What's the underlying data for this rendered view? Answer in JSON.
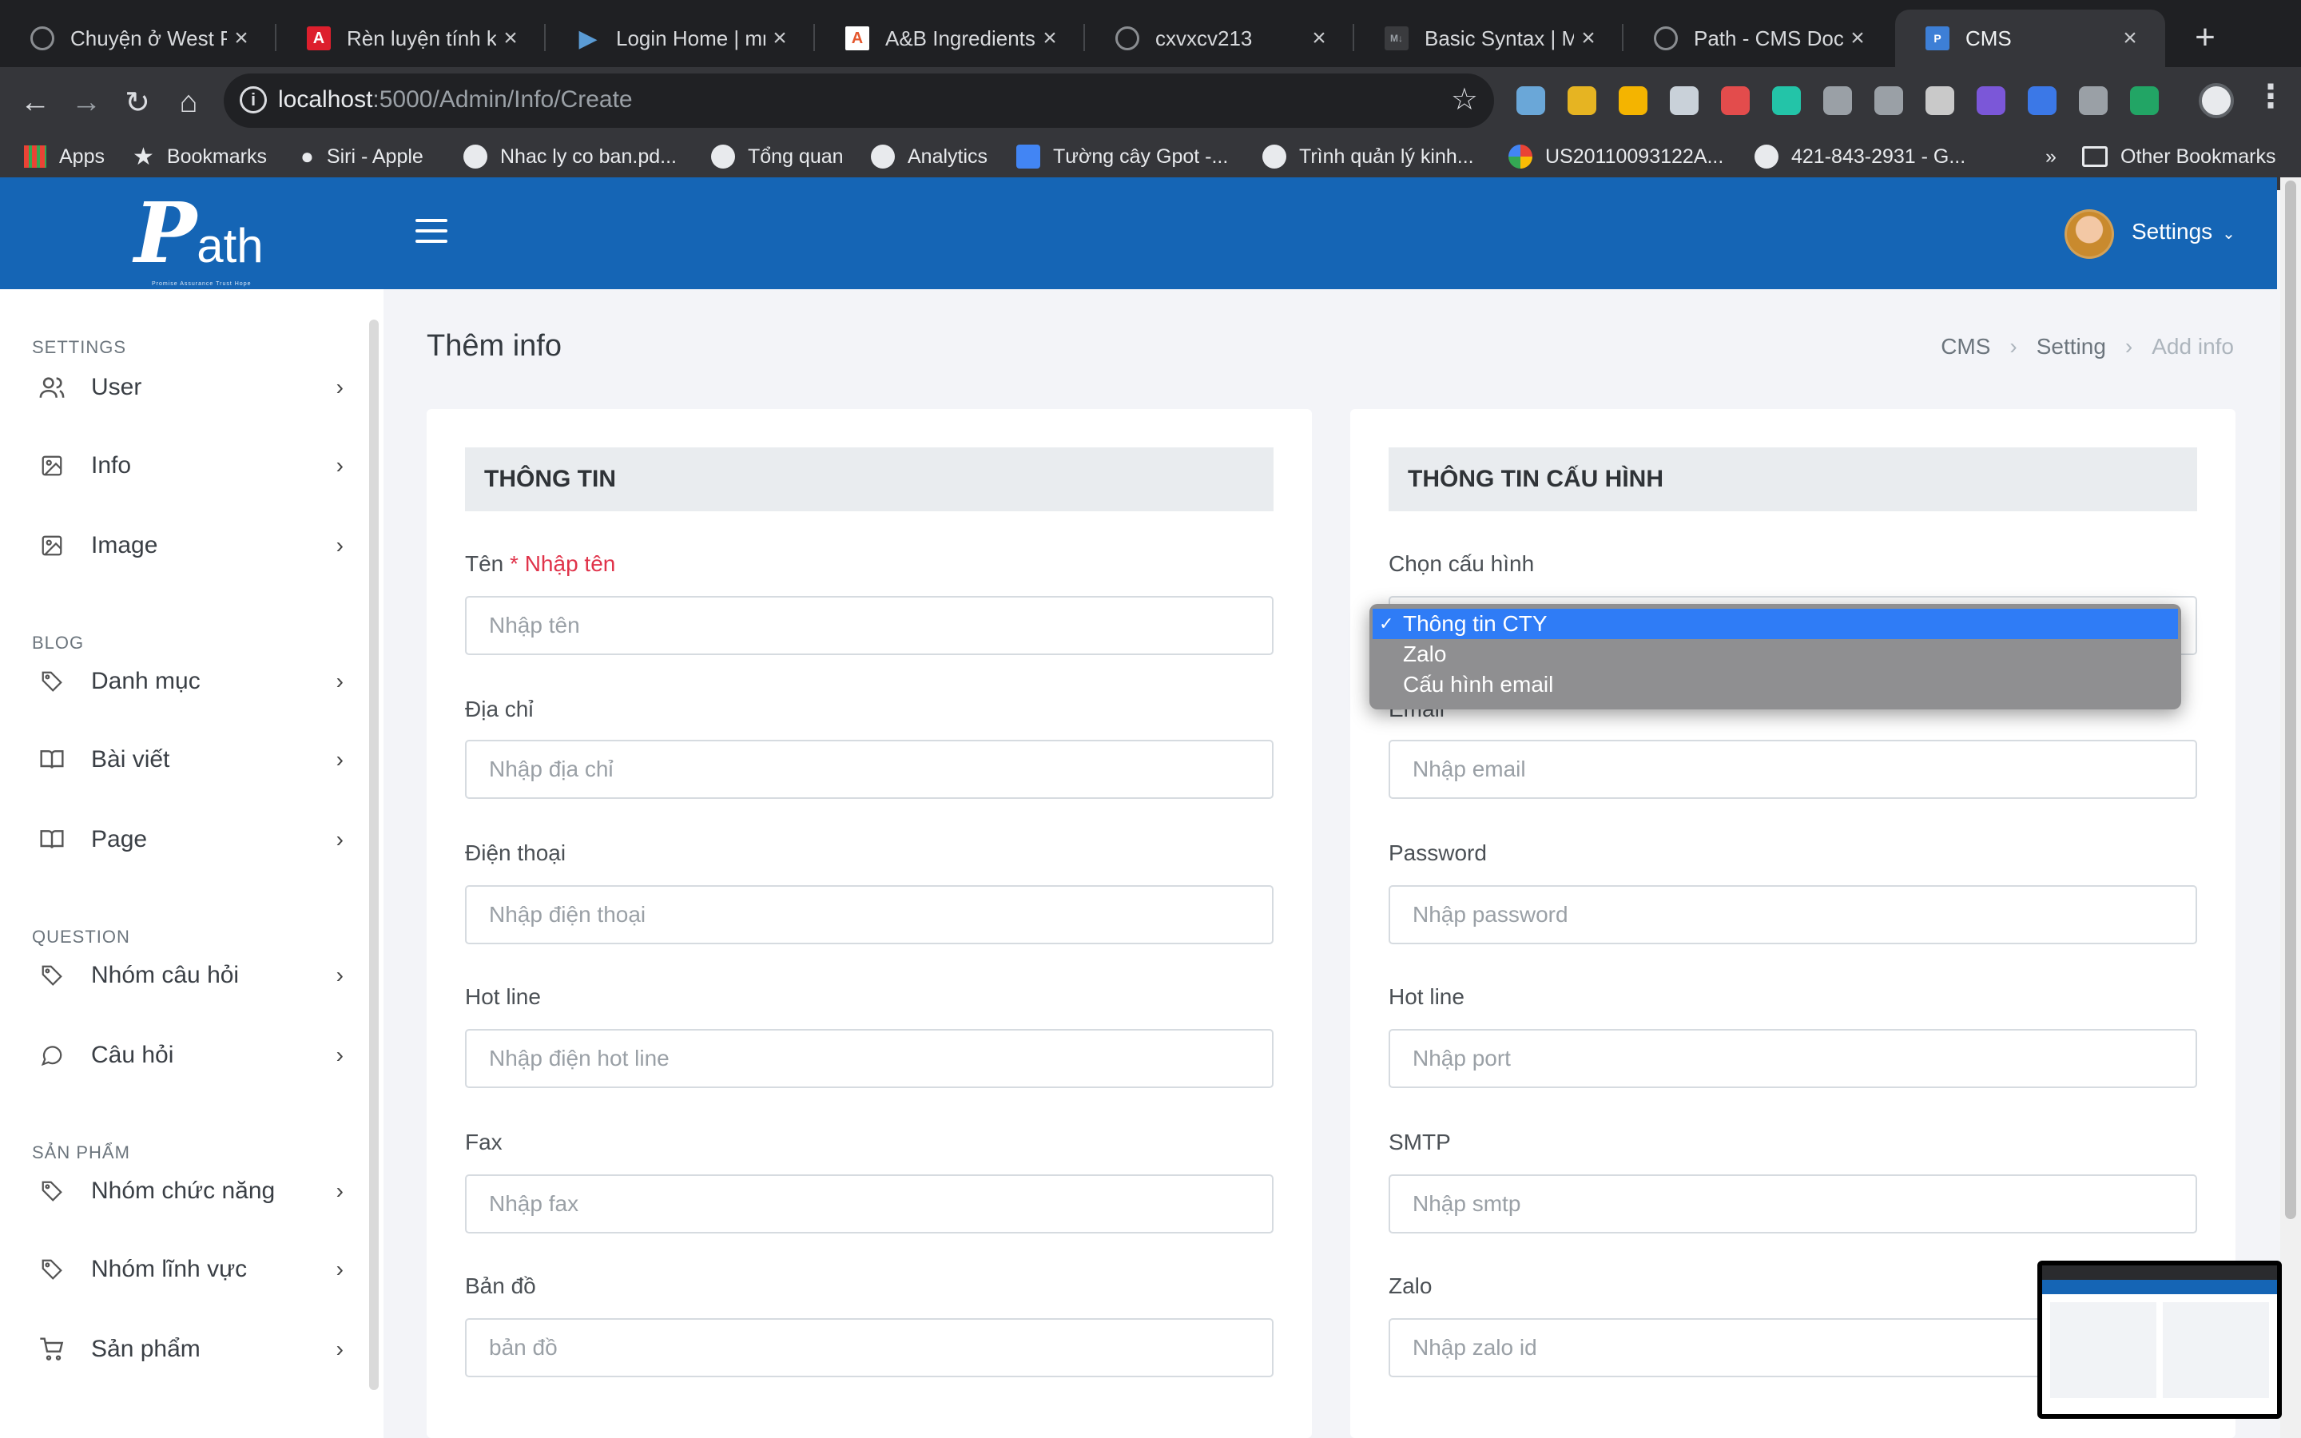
{
  "browser": {
    "tabs": [
      {
        "title": "Chuyện ở West Po",
        "fav_color": "#8a8d91"
      },
      {
        "title": "Rèn luyện tính kỷ l",
        "fav_color": "#dd1f2d"
      },
      {
        "title": "Login Home | mmr",
        "fav_color": "#5a9bd4"
      },
      {
        "title": "A&B Ingredients -",
        "fav_color": "#e4572e"
      },
      {
        "title": "cxvxcv213",
        "fav_color": "#8a8d91"
      },
      {
        "title": "Basic Syntax | Mar",
        "fav_color": "#8a8d91"
      },
      {
        "title": "Path - CMS Docum",
        "fav_color": "#8a8d91"
      },
      {
        "title": "CMS",
        "fav_color": "#3d7fd6",
        "active": true
      }
    ],
    "url_host": "localhost",
    "url_path": ":5000/Admin/Info/Create",
    "bookmarks": [
      "Apps",
      "Bookmarks",
      "Siri - Apple",
      "Nhac ly co ban.pd...",
      "Tổng quan",
      "Analytics",
      "Tường cây Gpot -...",
      "Trình quản lý kinh...",
      "US20110093122A...",
      "421-843-2931 - G...",
      "»",
      "Other Bookmarks"
    ],
    "extension_colors": [
      "#6aa7d8",
      "#e6b422",
      "#f4b400",
      "#c9d1d9",
      "#e34c4c",
      "#23c4a8",
      "#9aa0a6",
      "#9aa0a6",
      "#c9c9c9",
      "#7b57d8",
      "#3b78e7",
      "#9aa0a6",
      "#22a565"
    ]
  },
  "header": {
    "logo_big": "P",
    "logo_rest": "ath",
    "logo_tagline": "Promise Assurance Trust Hope",
    "settings_label": "Settings"
  },
  "sidebar": {
    "sections": [
      {
        "title": "SETTINGS",
        "items": [
          {
            "label": "User",
            "icon": "users-icon"
          },
          {
            "label": "Info",
            "icon": "image-icon"
          },
          {
            "label": "Image",
            "icon": "image-icon"
          }
        ]
      },
      {
        "title": "BLOG",
        "items": [
          {
            "label": "Danh mục",
            "icon": "tag-icon"
          },
          {
            "label": "Bài viết",
            "icon": "book-icon"
          },
          {
            "label": "Page",
            "icon": "book-icon"
          }
        ]
      },
      {
        "title": "QUESTION",
        "items": [
          {
            "label": "Nhóm câu hỏi",
            "icon": "tag-icon"
          },
          {
            "label": "Câu hỏi",
            "icon": "message-icon"
          }
        ]
      },
      {
        "title": "SẢN PHẨM",
        "items": [
          {
            "label": "Nhóm chức năng",
            "icon": "tag-icon"
          },
          {
            "label": "Nhóm lĩnh vực",
            "icon": "tag-icon"
          },
          {
            "label": "Sản phẩm",
            "icon": "cart-icon"
          }
        ]
      }
    ]
  },
  "main": {
    "title": "Thêm info",
    "breadcrumb": [
      "CMS",
      "Setting",
      "Add info"
    ]
  },
  "left_card": {
    "heading": "THÔNG TIN",
    "fields": [
      {
        "label": "Tên",
        "required_label": "* Nhập tên",
        "placeholder": "Nhập tên"
      },
      {
        "label": "Địa chỉ",
        "placeholder": "Nhập địa chỉ"
      },
      {
        "label": "Điện thoại",
        "placeholder": "Nhập điện thoại"
      },
      {
        "label": "Hot line",
        "placeholder": "Nhập điện hot line"
      },
      {
        "label": "Fax",
        "placeholder": "Nhập fax"
      },
      {
        "label": "Bản đồ",
        "placeholder": "bản đồ"
      }
    ]
  },
  "right_card": {
    "heading": "THÔNG TIN CẤU HÌNH",
    "select_label": "Chọn cấu hình",
    "select_options": [
      "Thông tin CTY",
      "Zalo",
      "Cấu hình email"
    ],
    "selected_index": 0,
    "fields": [
      {
        "label": "Email",
        "placeholder": "Nhập email"
      },
      {
        "label": "Password",
        "placeholder": "Nhập password"
      },
      {
        "label": "Hot line",
        "placeholder": "Nhập port"
      },
      {
        "label": "SMTP",
        "placeholder": "Nhập smtp"
      },
      {
        "label": "Zalo",
        "placeholder": "Nhập zalo id"
      }
    ]
  }
}
